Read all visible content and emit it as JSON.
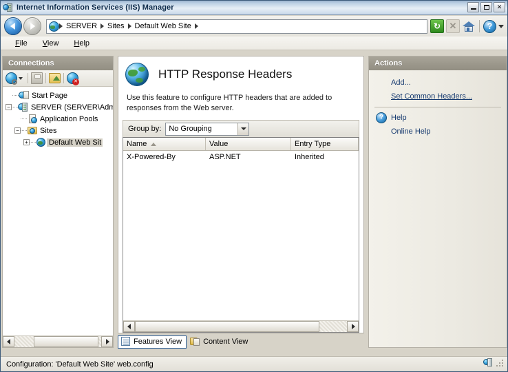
{
  "window": {
    "title": "Internet Information Services (IIS) Manager",
    "icon": "iis-server-icon",
    "buttons": {
      "minimize": "minimize-button",
      "maximize": "maximize-button",
      "close": "✕"
    }
  },
  "addressbar": {
    "back": "back-button",
    "forward": "forward-button",
    "breadcrumbs": [
      "SERVER",
      "Sites",
      "Default Web Site"
    ],
    "separator": "▸",
    "tools": {
      "refresh": "↻",
      "stop": "✕",
      "home": "home-icon",
      "help": "?",
      "help_caret": "chevron-down-icon"
    }
  },
  "menu": {
    "items": [
      {
        "accel": "F",
        "rest": "ile"
      },
      {
        "accel": "V",
        "rest": "iew"
      },
      {
        "accel": "H",
        "rest": "elp"
      }
    ]
  },
  "connections": {
    "header": "Connections",
    "toolbar": {
      "connect": "connect-to-server-icon",
      "save": "save-connection-icon",
      "open": "open-folder-icon",
      "disconnect": "disconnect-icon"
    },
    "tree": [
      {
        "label": "Start Page",
        "icon": "start-page-icon",
        "indent": 0,
        "expander": "",
        "selected": false
      },
      {
        "label": "SERVER (SERVER\\Admin",
        "icon": "server-icon",
        "indent": 0,
        "expander": "−",
        "selected": false
      },
      {
        "label": "Application Pools",
        "icon": "application-pools-icon",
        "indent": 1,
        "expander": "",
        "selected": false
      },
      {
        "label": "Sites",
        "icon": "sites-folder-icon",
        "indent": 1,
        "expander": "−",
        "selected": false
      },
      {
        "label": "Default Web Sit",
        "icon": "web-site-icon",
        "indent": 2,
        "expander": "+",
        "selected": true
      }
    ]
  },
  "content": {
    "feature_title": "HTTP Response Headers",
    "feature_icon": "http-response-headers-icon",
    "description": "Use this feature to configure HTTP headers that are added to responses from the Web server.",
    "groupby_label": "Group by:",
    "groupby_value": "No Grouping",
    "columns": [
      {
        "label": "Name",
        "sorted": "asc"
      },
      {
        "label": "Value",
        "sorted": ""
      },
      {
        "label": "Entry Type",
        "sorted": ""
      }
    ],
    "rows": [
      {
        "name": "X-Powered-By",
        "value": "ASP.NET",
        "entry_type": "Inherited"
      }
    ],
    "tabs": [
      {
        "label": "Features View",
        "icon": "features-view-icon",
        "active": true
      },
      {
        "label": "Content View",
        "icon": "content-view-icon",
        "active": false
      }
    ]
  },
  "actions": {
    "header": "Actions",
    "items": [
      {
        "label": "Add...",
        "icon": "",
        "hovered": false
      },
      {
        "label": "Set Common Headers...",
        "icon": "",
        "hovered": true
      },
      {
        "label": "Help",
        "icon": "help-icon",
        "hovered": false
      },
      {
        "label": "Online Help",
        "icon": "",
        "hovered": false
      }
    ]
  },
  "statusbar": {
    "text": "Configuration: 'Default Web Site' web.config",
    "icon": "server-status-icon"
  },
  "colors": {
    "title_accent": "#0c2a4a",
    "panel_header": "#928e82",
    "link": "#14386e",
    "selection": "#d5d1c6"
  }
}
